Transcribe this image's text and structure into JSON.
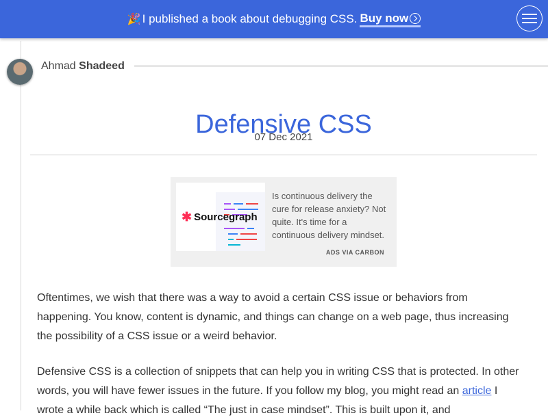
{
  "banner": {
    "emoji": "🎉",
    "text": "I published a book about debugging CSS.",
    "buy_label": "Buy now"
  },
  "author": {
    "first": "Ahmad",
    "last": "Shadeed"
  },
  "article": {
    "title": "Defensive CSS",
    "date": "07 Dec 2021"
  },
  "ad": {
    "brand": "Sourcegraph",
    "text": "Is continuous delivery the cure for release anxiety? Not quite. It's time for a continuous delivery mindset.",
    "via": "ADS VIA CARBON"
  },
  "body": {
    "p1": "Oftentimes, we wish that there was a way to avoid a certain CSS issue or behaviors from happening. You know, content is dynamic, and things can change on a web page, thus increasing the possibility of a CSS issue or a weird behavior.",
    "p2_start": "Defensive CSS is a collection of snippets that can help you in writing CSS that is protected. In other words, you will have fewer issues in the future. If you follow my blog, you might read an ",
    "p2_link": "article",
    "p2_end": " I wrote a while back which is called “The just in case mindset”. This is built upon it, and"
  },
  "colors": {
    "accent": "#3b66db",
    "ad_background": "#f0f0f0"
  }
}
